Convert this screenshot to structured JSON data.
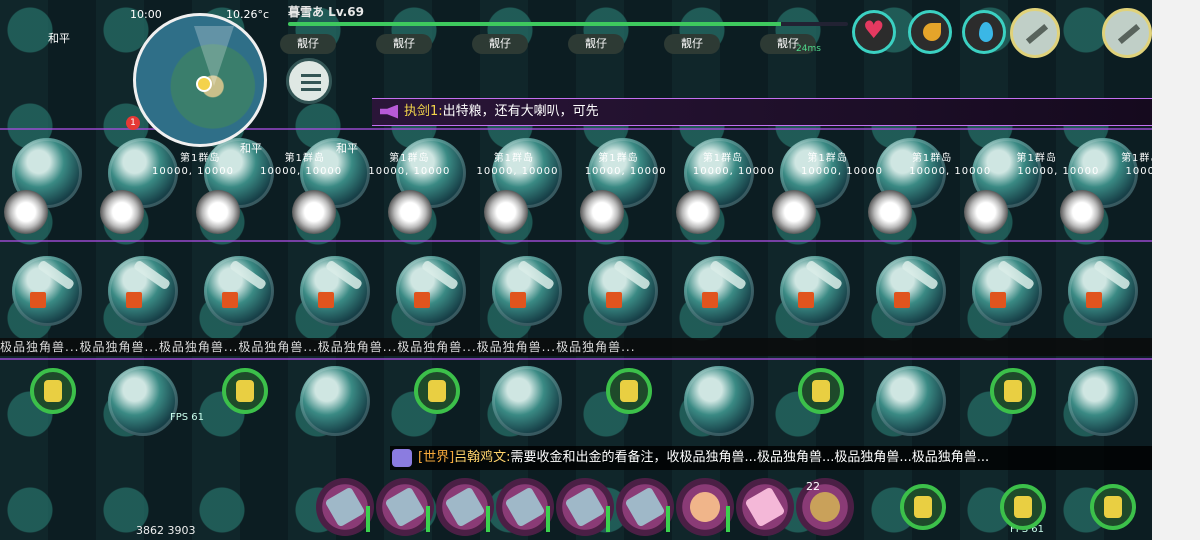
{
  "hud": {
    "player_name_level": "暮雪あ Lv.69",
    "clock": "10:00",
    "temperature": "10.26°c",
    "hp_fraction": 0.88,
    "ping": "24ms",
    "mail_count": "1",
    "team_labels": [
      "靓仔",
      "靓仔",
      "靓仔",
      "靓仔",
      "靓仔",
      "靓仔"
    ]
  },
  "notice": {
    "sender": "执剑1:",
    "message": "出特粮，还有大喇叭，可先"
  },
  "chat": {
    "channel": "[世界]",
    "sender": "吕翰鸡文:",
    "message": "需要收金和出金的看备注，收极品独角兽...极品独角兽...极品独角兽...极品独角兽..."
  },
  "world_labels": {
    "island": "第1群岛",
    "coords": "10000, 10000",
    "peace": "和平",
    "banner": "极品独角兽...极品独角兽...极品独角兽...极品独角兽...极品独角兽...极品独角兽...极品独角兽...极品独角兽...",
    "fps": "FPS 61",
    "score": "3862 3903"
  },
  "hotbar": {
    "stack_count": "22",
    "slots": [
      "axe-icon",
      "spear-icon",
      "crossbow-icon",
      "staff-icon",
      "pickaxe-icon",
      "sword-icon",
      "fan-icon",
      "rabbit-cup-icon",
      "food-icon"
    ]
  },
  "colors": {
    "accent_green": "#3ec95e",
    "notice_purple": "#c46ff0",
    "chat_channel": "#f6a93b"
  }
}
